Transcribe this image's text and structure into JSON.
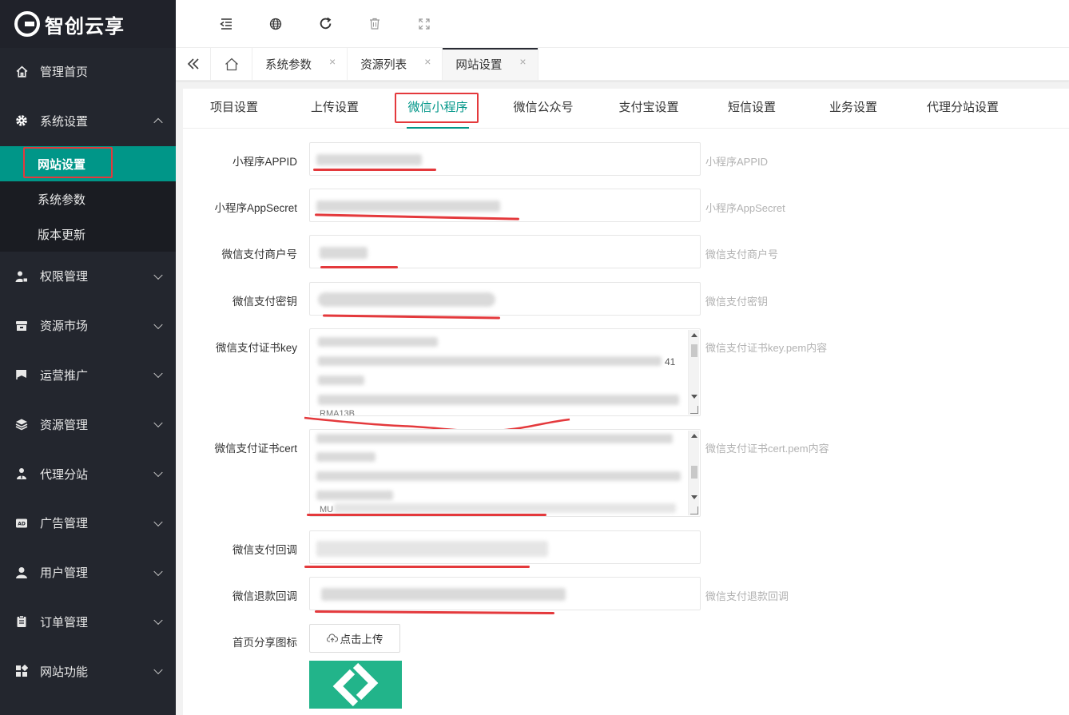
{
  "app": {
    "logo_text": "智创云享"
  },
  "sidebar": {
    "items": [
      {
        "label": "管理首页",
        "icon": "home-icon"
      },
      {
        "label": "系统设置",
        "icon": "gear-icon",
        "expanded": true
      },
      {
        "label": "权限管理",
        "icon": "user-lock-icon"
      },
      {
        "label": "资源市场",
        "icon": "store-icon"
      },
      {
        "label": "运营推广",
        "icon": "flag-icon"
      },
      {
        "label": "资源管理",
        "icon": "layers-icon"
      },
      {
        "label": "代理分站",
        "icon": "agent-icon"
      },
      {
        "label": "广告管理",
        "icon": "ad-icon"
      },
      {
        "label": "用户管理",
        "icon": "user-icon"
      },
      {
        "label": "订单管理",
        "icon": "clipboard-icon"
      },
      {
        "label": "网站功能",
        "icon": "apps-icon"
      }
    ],
    "sub_items": [
      "网站设置",
      "系统参数",
      "版本更新"
    ]
  },
  "header": {
    "icons": [
      "indent-icon",
      "globe-icon",
      "refresh-icon",
      "trash-icon",
      "fullscreen-icon"
    ]
  },
  "tabbar": {
    "tabs": [
      {
        "label": "系统参数"
      },
      {
        "label": "资源列表"
      },
      {
        "label": "网站设置",
        "active": true
      }
    ],
    "close_glyph": "×"
  },
  "settings_tabs": [
    "项目设置",
    "上传设置",
    "微信小程序",
    "微信公众号",
    "支付宝设置",
    "短信设置",
    "业务设置",
    "代理分站设置"
  ],
  "form": {
    "appid": {
      "label": "小程序APPID",
      "hint": "小程序APPID"
    },
    "appsecret": {
      "label": "小程序AppSecret",
      "hint": "小程序AppSecret"
    },
    "mchid": {
      "label": "微信支付商户号",
      "hint": "微信支付商户号"
    },
    "paykey": {
      "label": "微信支付密钥",
      "hint": "微信支付密钥"
    },
    "certkey": {
      "label": "微信支付证书key",
      "hint": "微信支付证书key.pem内容",
      "visible_fragments": [
        "41",
        "RMA13B"
      ]
    },
    "certpem": {
      "label": "微信支付证书cert",
      "hint": "微信支付证书cert.pem内容",
      "visible_fragments": [
        "MU"
      ]
    },
    "notify": {
      "label": "微信支付回调"
    },
    "refund": {
      "label": "微信退款回调",
      "hint": "微信支付退款回调"
    },
    "share_icon": {
      "label": "首页分享图标",
      "button": "点击上传"
    }
  },
  "colors": {
    "accent": "#009688",
    "sidebar_bg": "#23262e",
    "annotation_red": "#e4393c",
    "share_icon_bg": "#22b48a"
  }
}
